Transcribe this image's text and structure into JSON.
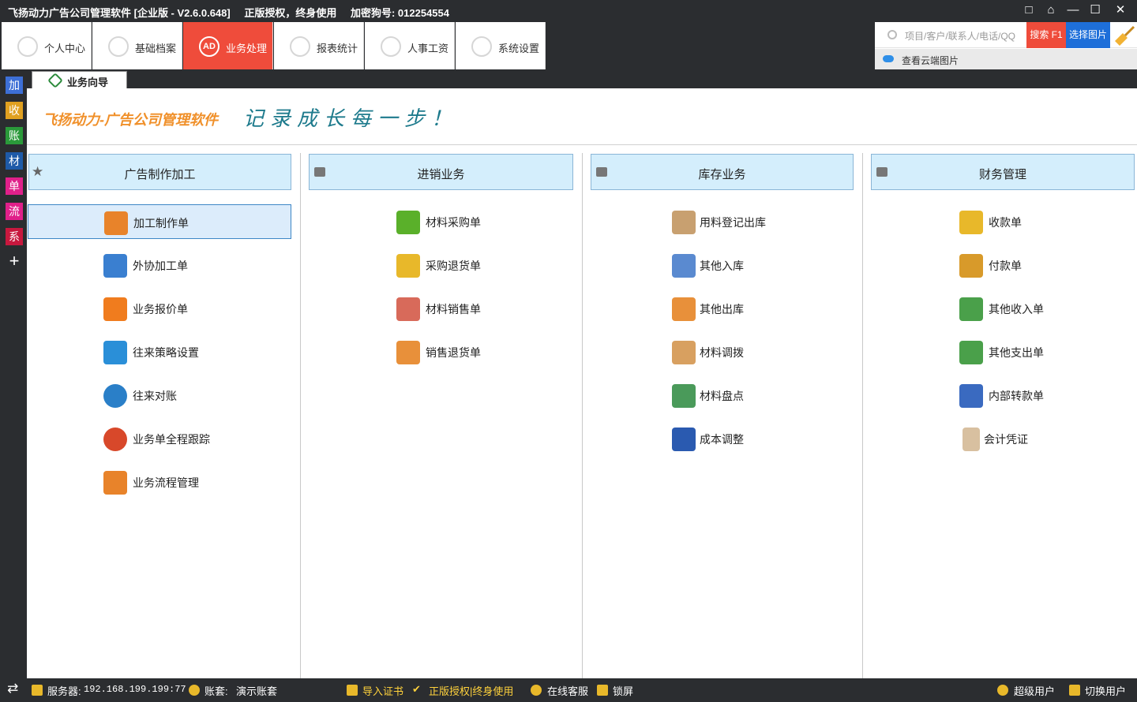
{
  "window": {
    "title_parts": [
      "飞扬动力广告公司管理软件 [企业版 - V2.6.0.648]",
      "正版授权，终身使用",
      "加密狗号: 012254554"
    ],
    "controls": [
      "□",
      "⌂",
      "—",
      "☐",
      "✕"
    ]
  },
  "nav": {
    "tabs": [
      {
        "label": "个人中心",
        "icon": "user-icon"
      },
      {
        "label": "基础档案",
        "icon": "list-icon"
      },
      {
        "label": "业务处理",
        "icon": "ad-icon",
        "icon_text": "AD"
      },
      {
        "label": "报表统计",
        "icon": "chart-icon"
      },
      {
        "label": "人事工资",
        "icon": "wage-icon"
      },
      {
        "label": "系统设置",
        "icon": "gear-icon"
      }
    ],
    "active_index": 2
  },
  "search": {
    "placeholder": "项目/客户/联系人/电话/QQ",
    "search_button": "搜索 F1",
    "image_button": "选择图片",
    "cloud_link": "查看云端图片"
  },
  "sidebar": {
    "items": [
      {
        "label": "加",
        "color": "#3d6fd6"
      },
      {
        "label": "收",
        "color": "#e0a020"
      },
      {
        "label": "账",
        "color": "#2a9a3a"
      },
      {
        "label": "材",
        "color": "#1e5aa8"
      },
      {
        "label": "单",
        "color": "#e0208a"
      },
      {
        "label": "流",
        "color": "#e0208a"
      },
      {
        "label": "系",
        "color": "#c8183e"
      }
    ],
    "plus": "+"
  },
  "tab": {
    "label": "业务向导"
  },
  "banner": {
    "logo": "飞扬动力-广告公司管理软件",
    "slogan": "记录成长每一步！"
  },
  "columns": [
    {
      "title": "广告制作加工",
      "items": [
        {
          "label": "加工制作单",
          "icon": "clipboard-icon",
          "color": "#e8832a"
        },
        {
          "label": "外协加工单",
          "icon": "doc-check-icon",
          "color": "#3a7fd0"
        },
        {
          "label": "业务报价单",
          "icon": "checklist-icon",
          "color": "#f07c1e"
        },
        {
          "label": "往来策略设置",
          "icon": "chat-icon",
          "color": "#2a8fd8"
        },
        {
          "label": "往来对账",
          "icon": "magnifier-icon",
          "color": "#2a7fc8"
        },
        {
          "label": "业务单全程跟踪",
          "icon": "clock-icon",
          "color": "#d8482a"
        },
        {
          "label": "业务流程管理",
          "icon": "flow-icon",
          "color": "#e8832a"
        }
      ]
    },
    {
      "title": "进销业务",
      "items": [
        {
          "label": "材料采购单",
          "icon": "basket-green-icon",
          "color": "#5ab02a"
        },
        {
          "label": "采购退货单",
          "icon": "basket-yellow-icon",
          "color": "#e8b82a"
        },
        {
          "label": "材料销售单",
          "icon": "tags-icon",
          "color": "#d86a5a"
        },
        {
          "label": "销售退货单",
          "icon": "boxes-icon",
          "color": "#e8903a"
        }
      ]
    },
    {
      "title": "库存业务",
      "items": [
        {
          "label": "用料登记出库",
          "icon": "notepad-icon",
          "color": "#c8a070"
        },
        {
          "label": "其他入库",
          "icon": "cart-in-icon",
          "color": "#5a8ad0"
        },
        {
          "label": "其他出库",
          "icon": "cart-out-icon",
          "color": "#e8903a"
        },
        {
          "label": "材料调拨",
          "icon": "transfer-icon",
          "color": "#d8a060"
        },
        {
          "label": "材料盘点",
          "icon": "inventory-icon",
          "color": "#4a9a5a"
        },
        {
          "label": "成本调整",
          "icon": "magic-wand-icon",
          "color": "#2a5ab0"
        }
      ]
    },
    {
      "title": "财务管理",
      "items": [
        {
          "label": "收款单",
          "icon": "coins-icon",
          "color": "#e8b82a"
        },
        {
          "label": "付款单",
          "icon": "payer-icon",
          "color": "#d89a2a"
        },
        {
          "label": "其他收入单",
          "icon": "money-plus-icon",
          "color": "#4aa04a"
        },
        {
          "label": "其他支出单",
          "icon": "money-minus-icon",
          "color": "#4aa04a"
        },
        {
          "label": "内部转款单",
          "icon": "card-transfer-icon",
          "color": "#3a6ac0"
        },
        {
          "label": "会计凭证",
          "icon": "voucher-icon",
          "color": "#d8c0a0"
        }
      ]
    }
  ],
  "status": {
    "server_label": "服务器:",
    "server_value": "192.168.199.199:77",
    "account_label": "账套:",
    "account_value": "演示账套",
    "import_cert": "导入证书",
    "license": "正版授权|终身使用",
    "online_service": "在线客服",
    "lock": "锁屏",
    "super_user": "超级用户",
    "switch_user": "切换用户",
    "switch_glyph": "⇄"
  },
  "colors": {
    "chrome": "#2b2d30",
    "active_tab": "#ef4c3b",
    "search_button": "#ef4c3b",
    "image_button": "#1e6fd9",
    "section_header": "#d4eefc",
    "status_highlight": "#ffd23c"
  }
}
